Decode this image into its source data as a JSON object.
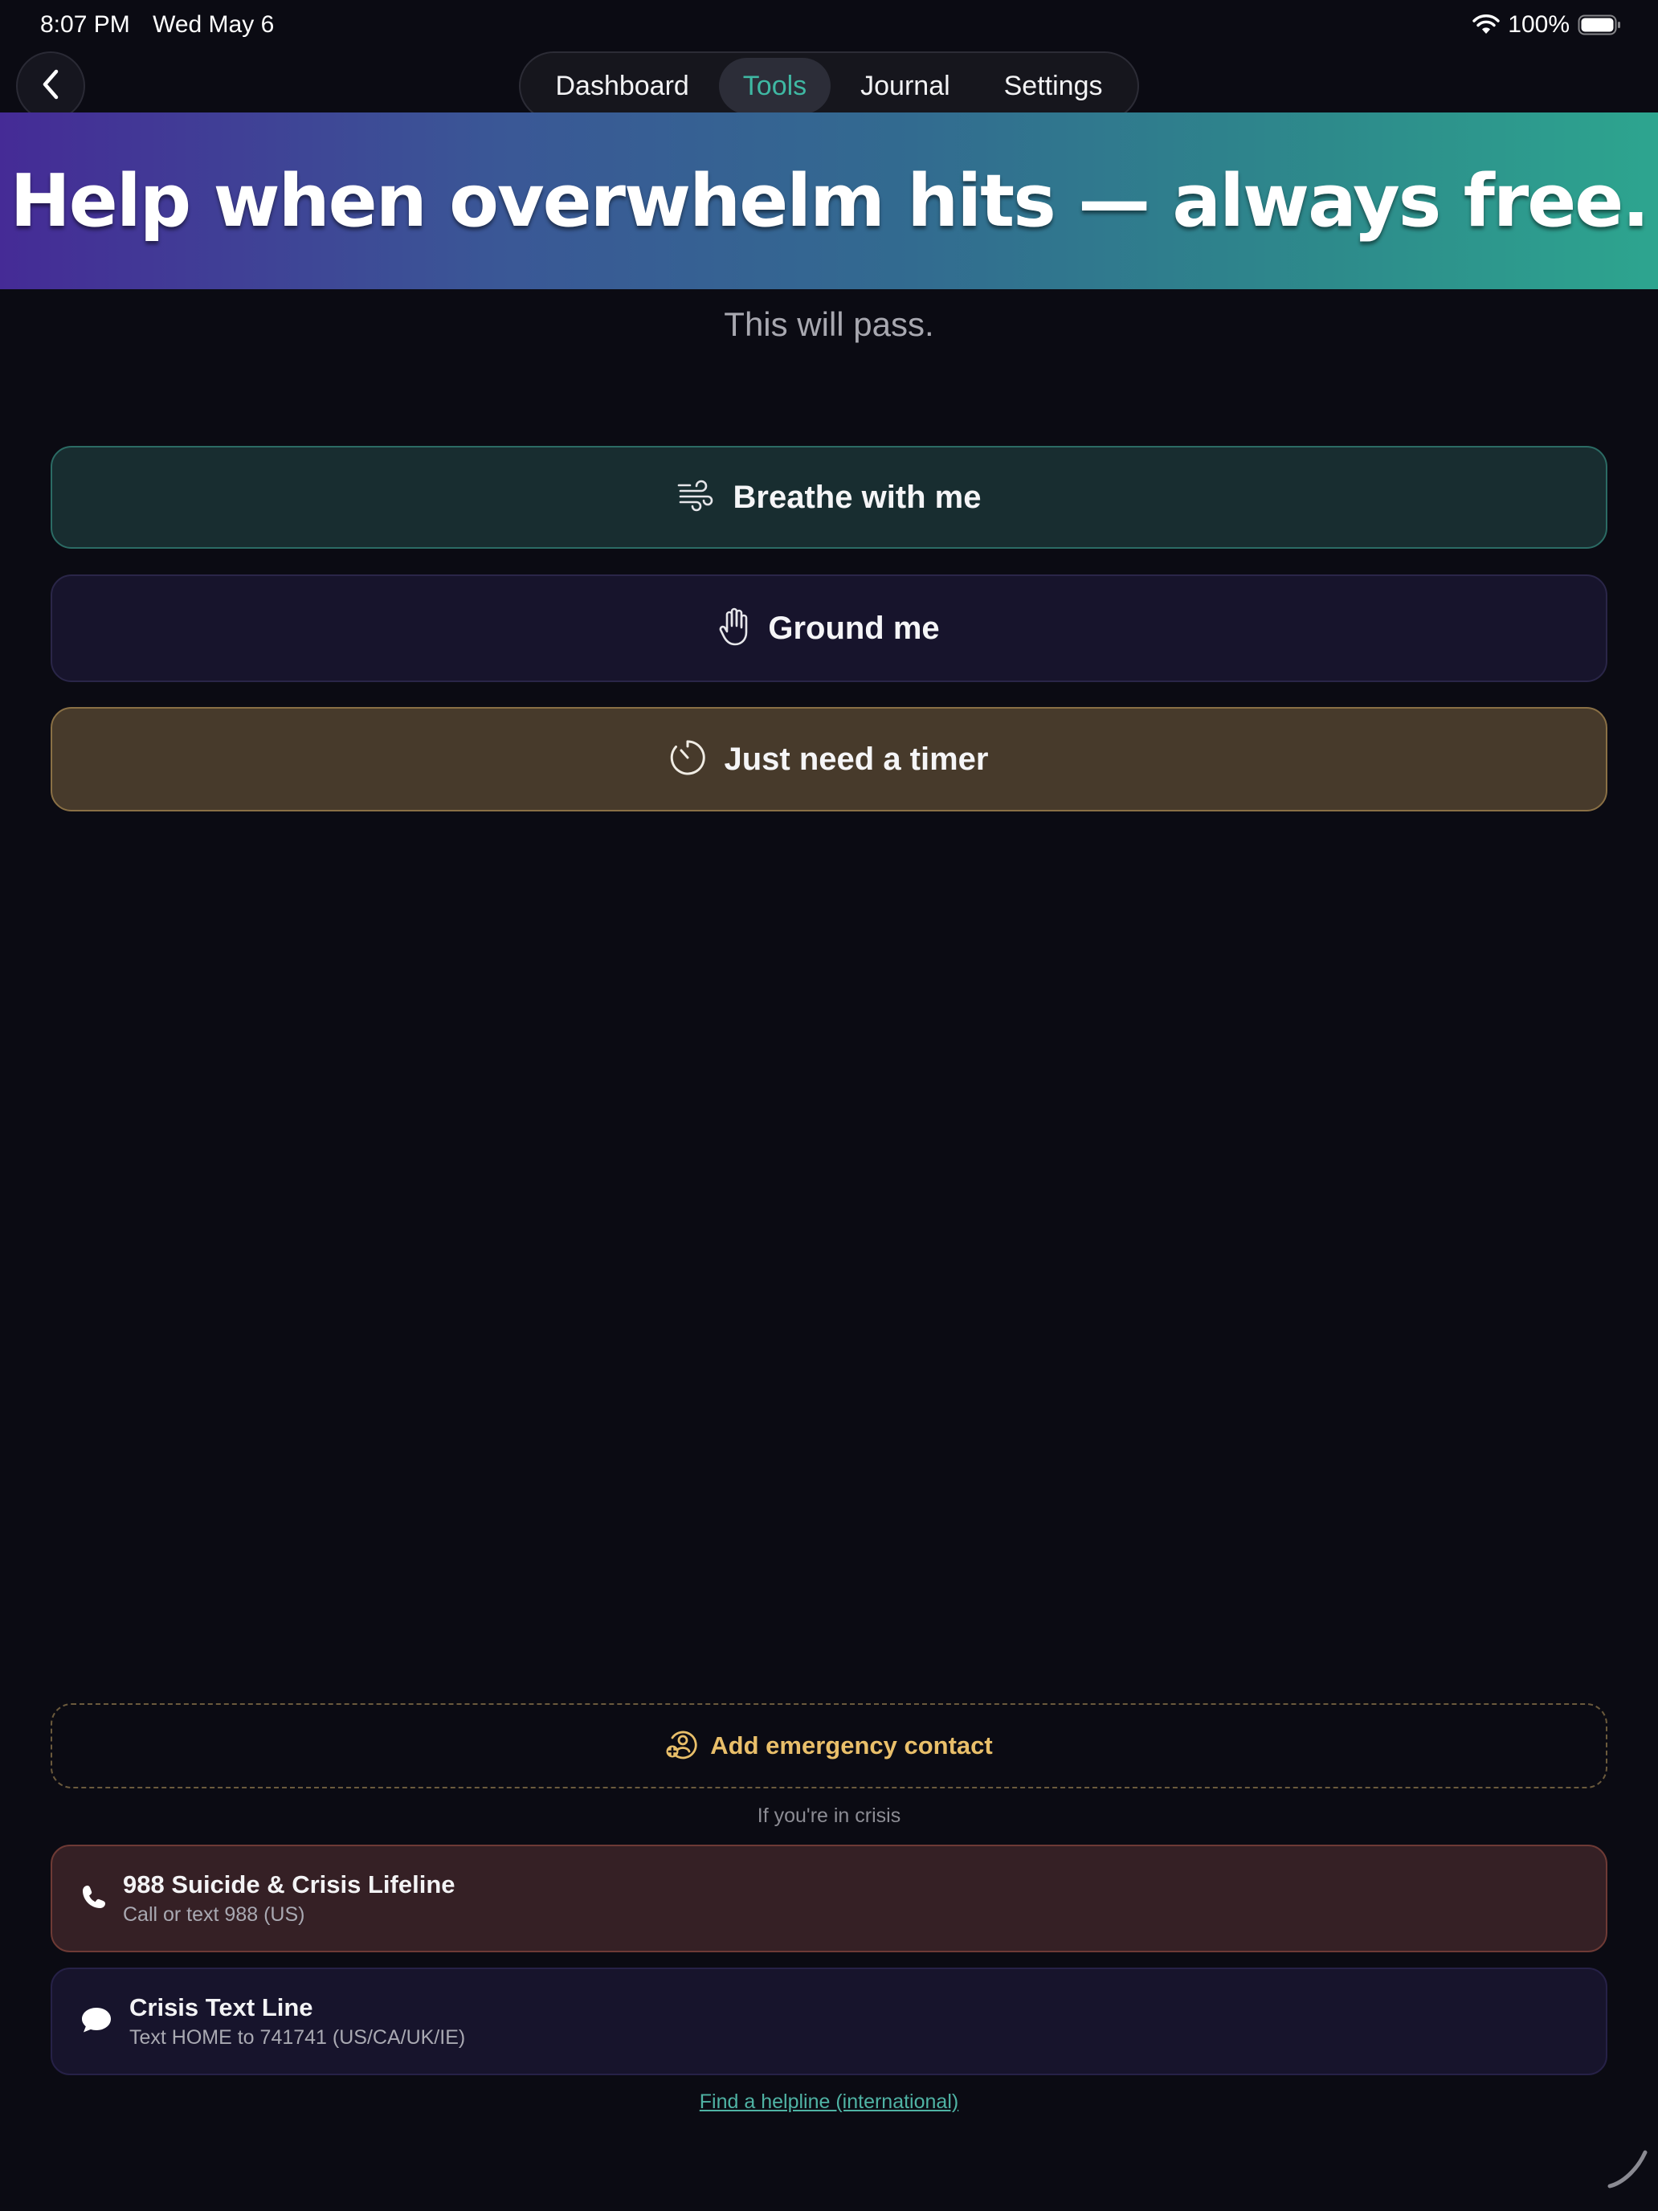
{
  "status_bar": {
    "time": "8:07 PM",
    "date": "Wed May 6",
    "battery": "100%"
  },
  "nav": {
    "tabs": [
      {
        "label": "Dashboard",
        "active": false
      },
      {
        "label": "Tools",
        "active": true
      },
      {
        "label": "Journal",
        "active": false
      },
      {
        "label": "Settings",
        "active": false
      }
    ]
  },
  "banner": {
    "text": "Help when overwhelm hits — always free."
  },
  "subtitle": "This will pass.",
  "actions": {
    "breathe": {
      "label": "Breathe with me",
      "icon": "wind-icon"
    },
    "ground": {
      "label": "Ground me",
      "icon": "hand-icon"
    },
    "timer": {
      "label": "Just need a timer",
      "icon": "timer-icon"
    }
  },
  "emergency": {
    "label": "Add emergency contact",
    "icon": "add-contact-icon"
  },
  "crisis": {
    "heading": "If you're in crisis",
    "lines": [
      {
        "name": "988 Suicide & Crisis Lifeline",
        "desc": "Call or text 988 (US)",
        "icon": "phone-icon"
      },
      {
        "name": "Crisis Text Line",
        "desc": "Text HOME to 741741 (US/CA/UK/IE)",
        "icon": "chat-bubble-icon"
      }
    ],
    "find_link": "Find a helpline (international)"
  },
  "colors": {
    "background": "#0b0b13",
    "accent_teal": "#3fb8a3",
    "accent_gold": "#e9bf6a",
    "banner_start": "#452b96",
    "banner_end": "#2da58f"
  }
}
